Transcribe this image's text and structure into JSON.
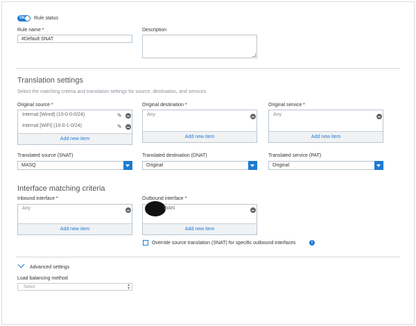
{
  "rule_status": {
    "toggle_text": "ON",
    "label": "Rule status"
  },
  "rule_name": {
    "label": "Rule name *",
    "value": "#Default SNAT"
  },
  "description": {
    "label": "Description",
    "value": ""
  },
  "translation": {
    "title": "Translation settings",
    "subtitle": "Select the matching criteria and translation settings for source, destination, and services",
    "original_source": {
      "label": "Original source *",
      "items": [
        "Internal [Wired] (10-0-0-0/24)",
        "Internal [WiFi] (10-0-1-0/24)"
      ],
      "add_label": "Add new item"
    },
    "original_destination": {
      "label": "Original destination *",
      "items": [
        "Any"
      ],
      "add_label": "Add new item"
    },
    "original_service": {
      "label": "Original service *",
      "items": [
        "Any"
      ],
      "add_label": "Add new item"
    },
    "translated_source": {
      "label": "Translated source (SNAT)",
      "value": "MASQ"
    },
    "translated_destination": {
      "label": "Translated destination (DNAT)",
      "value": "Original"
    },
    "translated_service": {
      "label": "Translated service (PAT)",
      "value": "Original"
    }
  },
  "interface": {
    "title": "Interface matching criteria",
    "inbound": {
      "label": "Inbound interface *",
      "items": [
        "Any"
      ],
      "add_label": "Add new item"
    },
    "outbound": {
      "label": "Outbound interface *",
      "items": [
        "WAN"
      ],
      "add_label": "Add new item"
    },
    "override_label": "Override source translation (SNAT) for specific outbound interfaces",
    "override_checked": false
  },
  "advanced": {
    "toggle_label": "Advanced settings",
    "load_balancing_label": "Load balancing method",
    "load_balancing_value": "Select"
  },
  "colors": {
    "accent": "#1e7ad1",
    "border": "#b8c4cf",
    "addbar": "#f0f2f4"
  },
  "icons": [
    "toggle-icon",
    "pencil-icon",
    "minus-circle-icon",
    "dropdown-arrow-icon",
    "info-icon",
    "chevron-down-icon"
  ]
}
